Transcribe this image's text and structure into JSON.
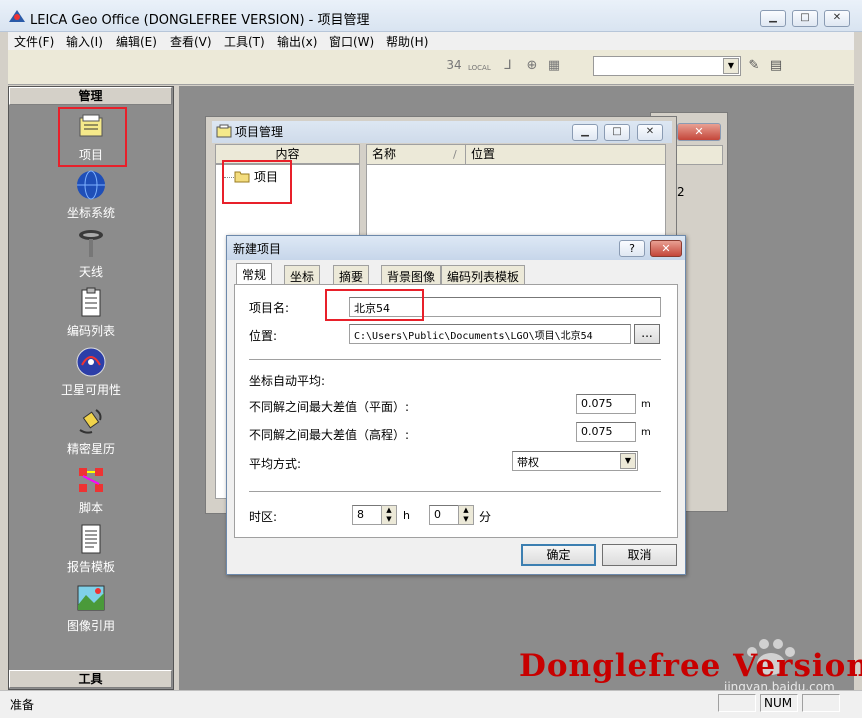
{
  "window": {
    "title": "LEICA Geo Office (DONGLEFREE VERSION) - 项目管理"
  },
  "menu": [
    "文件(F)",
    "输入(I)",
    "编辑(E)",
    "查看(V)",
    "工具(T)",
    "输出(x)",
    "窗口(W)",
    "帮助(H)"
  ],
  "toolbar": {
    "icons": [
      "gps-34-icon",
      "local-icon",
      "coordinate-axis-icon",
      "globe-icon",
      "grid-icon",
      "combo",
      "edit-icon",
      "panel-icon"
    ],
    "badge_34": "34",
    "badge_local": "LOCAL"
  },
  "left_panel": {
    "header": "管理",
    "footer": "工具",
    "items": [
      {
        "label": "项目",
        "icon": "project-icon",
        "selected": true
      },
      {
        "label": "坐标系统",
        "icon": "globe-icon"
      },
      {
        "label": "天线",
        "icon": "antenna-icon"
      },
      {
        "label": "编码列表",
        "icon": "codelist-icon"
      },
      {
        "label": "卫星可用性",
        "icon": "satellite-icon"
      },
      {
        "label": "精密星历",
        "icon": "ephemeris-icon"
      },
      {
        "label": "脚本",
        "icon": "script-icon"
      },
      {
        "label": "报告模板",
        "icon": "report-icon"
      },
      {
        "label": "图像引用",
        "icon": "image-icon"
      }
    ]
  },
  "project_window": {
    "title": "项目管理",
    "tree_header": "内容",
    "tree_root": "项目",
    "columns": [
      "名称",
      "位置"
    ],
    "back_digit": "2"
  },
  "dialog": {
    "title": "新建项目",
    "help": "?",
    "tabs": [
      "常规",
      "坐标",
      "摘要",
      "背景图像",
      "编码列表模板"
    ],
    "project_name_label": "项目名:",
    "project_name_value": "北京54",
    "location_label": "位置:",
    "location_value": "C:\\Users\\Public\\Documents\\LGO\\项目\\北京54",
    "browse": "...",
    "auto_avg_label": "坐标自动平均:",
    "plane_label": "不同解之间最大差值（平面）:",
    "plane_value": "0.075",
    "height_label": "不同解之间最大差值（高程）:",
    "height_value": "0.075",
    "unit_m": "m",
    "avg_method_label": "平均方式:",
    "avg_method_value": "带权",
    "timezone_label": "时区:",
    "tz_hours": "8",
    "tz_hours_unit": "h",
    "tz_minutes": "0",
    "tz_minutes_unit": "分",
    "ok": "确定",
    "cancel": "取消"
  },
  "status": {
    "left": "准备",
    "num": "NUM"
  },
  "watermark": "Donglefree Version",
  "site": {
    "logo": "Bai 经验",
    "url": "jingyan.baidu.com"
  },
  "colors": {
    "highlight": "#e8202a",
    "watermark": "#c80000",
    "mdi_bg": "#8c8c8c"
  }
}
